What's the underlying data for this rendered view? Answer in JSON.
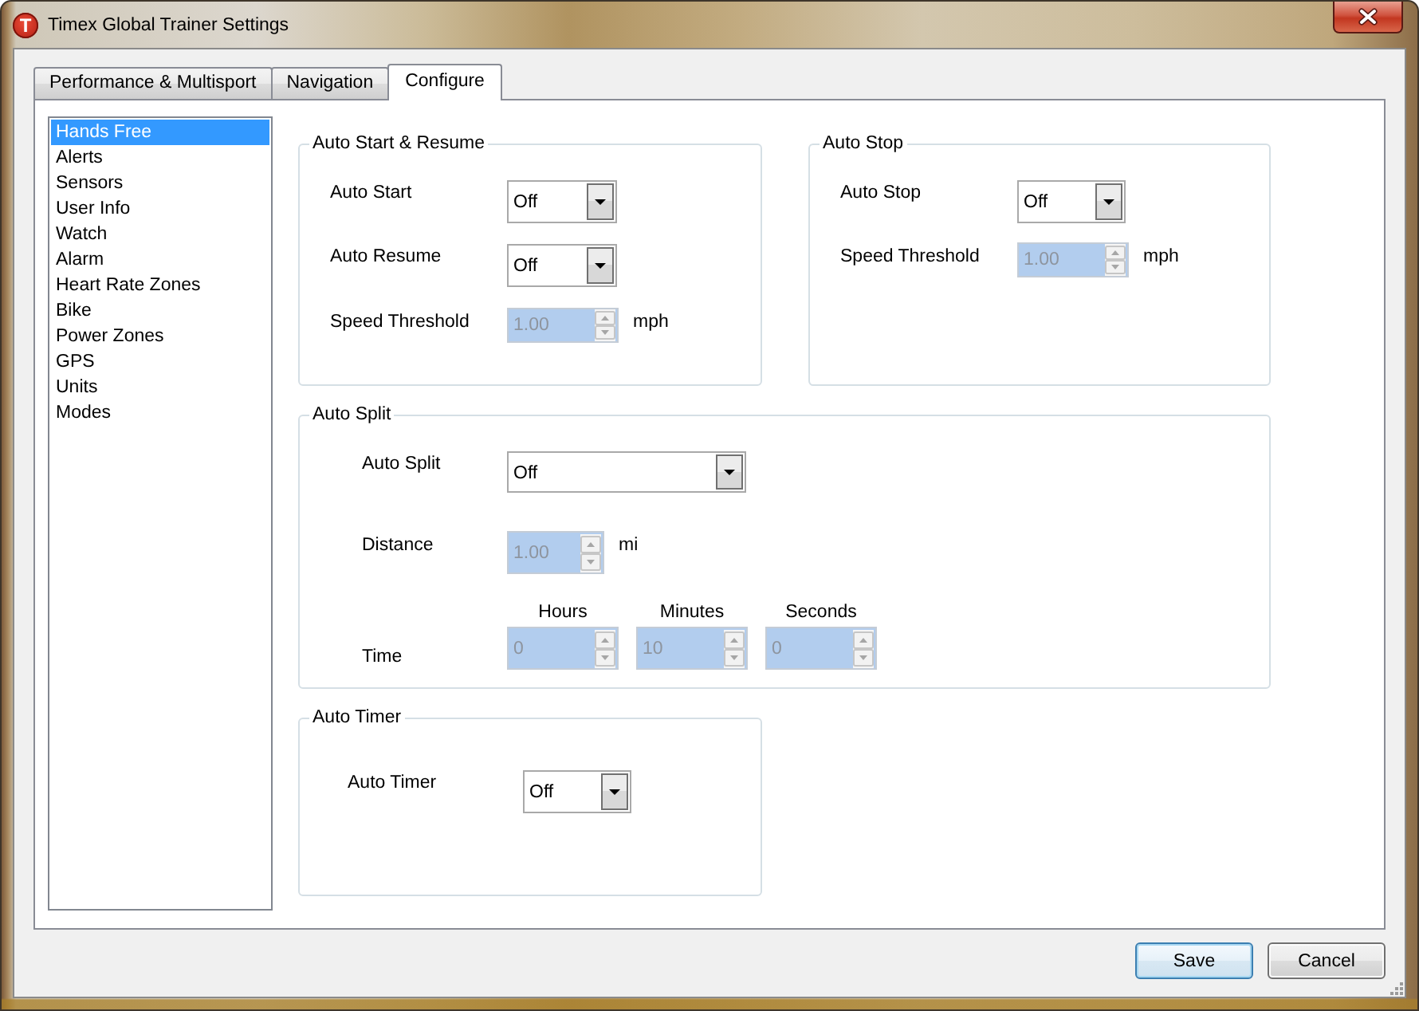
{
  "window": {
    "logo": "T",
    "title": "Timex Global Trainer Settings"
  },
  "tabs": [
    {
      "label": "Performance & Multisport",
      "selected": false
    },
    {
      "label": "Navigation",
      "selected": false
    },
    {
      "label": "Configure",
      "selected": true
    }
  ],
  "sidebar": {
    "items": [
      {
        "label": "Hands Free",
        "selected": true
      },
      {
        "label": "Alerts",
        "selected": false
      },
      {
        "label": "Sensors",
        "selected": false
      },
      {
        "label": "User Info",
        "selected": false
      },
      {
        "label": "Watch",
        "selected": false
      },
      {
        "label": "Alarm",
        "selected": false
      },
      {
        "label": "Heart Rate Zones",
        "selected": false
      },
      {
        "label": "Bike",
        "selected": false
      },
      {
        "label": "Power Zones",
        "selected": false
      },
      {
        "label": "GPS",
        "selected": false
      },
      {
        "label": "Units",
        "selected": false
      },
      {
        "label": "Modes",
        "selected": false
      }
    ]
  },
  "groups": [
    {
      "title": "Auto Start & Resume",
      "rows": [
        {
          "kind": "dropdown",
          "label": "Auto Start",
          "value": "Off"
        },
        {
          "kind": "dropdown",
          "label": "Auto Resume",
          "value": "Off"
        },
        {
          "kind": "spinner",
          "label": "Speed Threshold",
          "value": "1.00",
          "unit": "mph",
          "disabled": true
        }
      ]
    },
    {
      "title": "Auto Stop",
      "rows": [
        {
          "kind": "dropdown",
          "label": "Auto Stop",
          "value": "Off"
        },
        {
          "kind": "spinner",
          "label": "Speed Threshold",
          "value": "1.00",
          "unit": "mph",
          "disabled": true
        }
      ]
    },
    {
      "title": "Auto Split",
      "rows": [
        {
          "kind": "dropdown",
          "label": "Auto Split",
          "value": "Off"
        },
        {
          "kind": "spinner",
          "label": "Distance",
          "value": "1.00",
          "unit": "mi",
          "disabled": true
        },
        {
          "kind": "time",
          "label": "Time",
          "fields": [
            {
              "heading": "Hours",
              "value": "0",
              "disabled": true
            },
            {
              "heading": "Minutes",
              "value": "10",
              "disabled": true
            },
            {
              "heading": "Seconds",
              "value": "0",
              "disabled": true
            }
          ]
        }
      ]
    },
    {
      "title": "Auto Timer",
      "rows": [
        {
          "kind": "dropdown",
          "label": "Auto Timer",
          "value": "Off"
        }
      ]
    }
  ],
  "buttons": [
    {
      "label": "Save",
      "default": true
    },
    {
      "label": "Cancel",
      "default": false
    }
  ]
}
